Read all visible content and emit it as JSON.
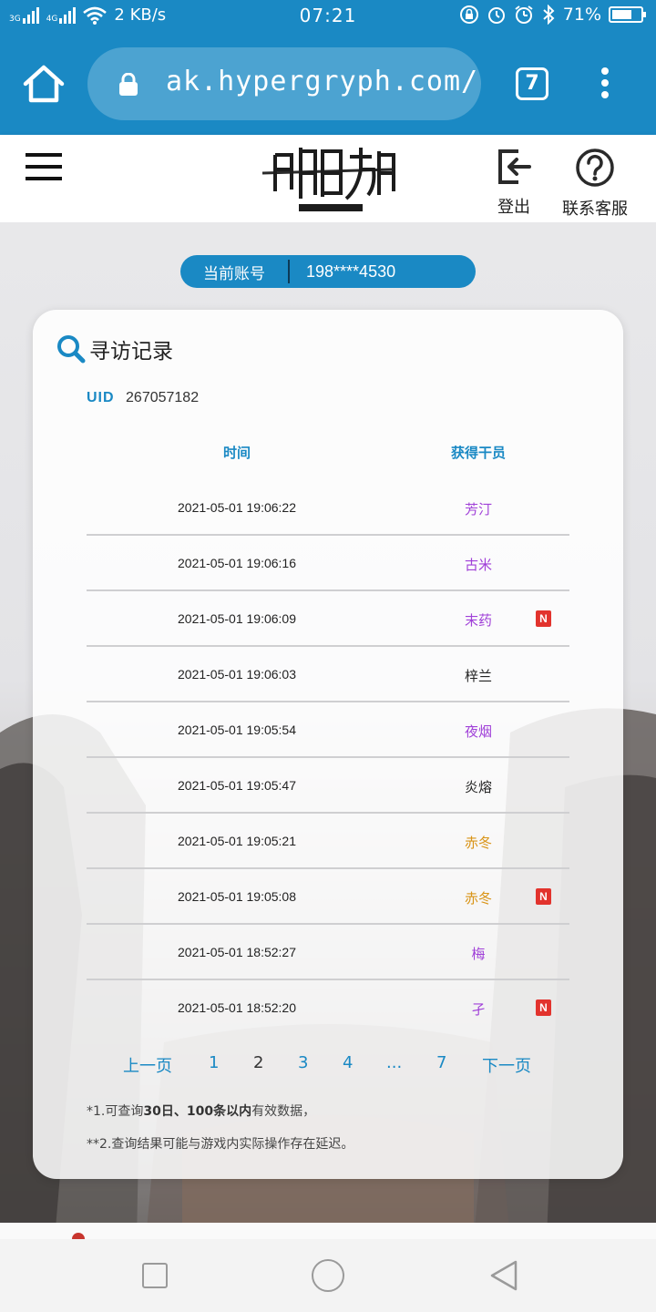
{
  "status_bar": {
    "net_left": "3G",
    "net_right": "4G",
    "speed": "2 KB/s",
    "time": "07:21",
    "battery": "71%",
    "battery_level": 0.71
  },
  "browser": {
    "url": "ak.hypergryph.com/us",
    "tab_count": "7"
  },
  "header": {
    "logout_label": "登出",
    "support_label": "联系客服"
  },
  "account": {
    "label": "当前账号",
    "value": "198****4530"
  },
  "records": {
    "title": "寻访记录",
    "uid_label": "UID",
    "uid_value": "267057182",
    "columns": [
      "时间",
      "获得干员"
    ],
    "rows": [
      {
        "time": "2021-05-01 19:06:22",
        "operator": "芳汀",
        "rarity": "purple",
        "new": ""
      },
      {
        "time": "2021-05-01 19:06:16",
        "operator": "古米",
        "rarity": "purple",
        "new": ""
      },
      {
        "time": "2021-05-01 19:06:09",
        "operator": "末药",
        "rarity": "purple",
        "new": "N"
      },
      {
        "time": "2021-05-01 19:06:03",
        "operator": "梓兰",
        "rarity": "plain",
        "new": ""
      },
      {
        "time": "2021-05-01 19:05:54",
        "operator": "夜烟",
        "rarity": "purple",
        "new": ""
      },
      {
        "time": "2021-05-01 19:05:47",
        "operator": "炎熔",
        "rarity": "plain",
        "new": ""
      },
      {
        "time": "2021-05-01 19:05:21",
        "operator": "赤冬",
        "rarity": "gold",
        "new": ""
      },
      {
        "time": "2021-05-01 19:05:08",
        "operator": "赤冬",
        "rarity": "gold",
        "new": "N"
      },
      {
        "time": "2021-05-01 18:52:27",
        "operator": "梅",
        "rarity": "purple",
        "new": ""
      },
      {
        "time": "2021-05-01 18:52:20",
        "operator": "孑",
        "rarity": "purple",
        "new": "N"
      }
    ],
    "pagination": {
      "prev": "上一页",
      "pages": [
        "1",
        "2",
        "3",
        "4",
        "...",
        "7"
      ],
      "current": "2",
      "next": "下一页"
    },
    "note1_prefix": "*1.可查询",
    "note1_bold": "30日、100条以内",
    "note1_suffix": "有效数据，",
    "note2": "**2.查询结果可能与游戏内实际操作存在延迟。"
  },
  "colors": {
    "brand_blue": "#1a89c4",
    "rarity_purple": "#a040d8",
    "rarity_gold": "#d99417",
    "new_badge": "#e2332d"
  },
  "icons": [
    "home-icon",
    "lock-icon",
    "tabs-icon",
    "more-icon",
    "menu-icon",
    "logout-icon",
    "help-icon",
    "search-icon"
  ]
}
